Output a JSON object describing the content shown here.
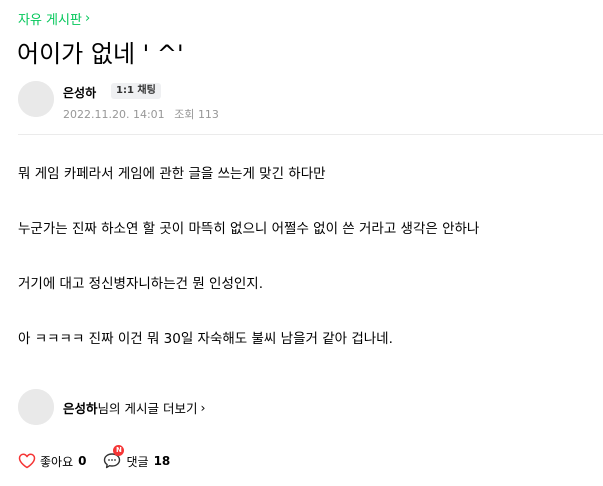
{
  "board": {
    "name": "자유 게시판",
    "chevron": "›"
  },
  "post": {
    "title": "어이가 없네 ' ^'",
    "author": {
      "nickname": "은성하",
      "chat_badge": "1:1 채팅",
      "avatar_icon": "default-profile-icon"
    },
    "date": "2022.11.20. 14:01",
    "views_label": "조회",
    "views": "113",
    "paragraphs": [
      "뭐 게임 카페라서 게임에 관한 글을 쓰는게 맞긴 하다만",
      "누군가는 진짜 하소연 할 곳이 마뜩히 없으니 어쩔수 없이 쓴 거라고 생각은 안하나",
      "거기에 대고 정신병자니하는건 뭔 인성인지.",
      "아 ㅋㅋㅋㅋ 진짜 이건 뭐 30일 자숙해도 불씨 남을거 같아 겁나네."
    ]
  },
  "more_posts": {
    "nickname": "은성하",
    "suffix": "님의 게시글 더보기",
    "chevron": "›"
  },
  "actions": {
    "like_label": "좋아요",
    "like_count": "0",
    "comment_label": "댓글",
    "comment_count": "18",
    "new_badge": "N"
  },
  "colors": {
    "accent_green": "#03c75a",
    "like_red": "#f53535",
    "meta_gray": "#979797"
  }
}
